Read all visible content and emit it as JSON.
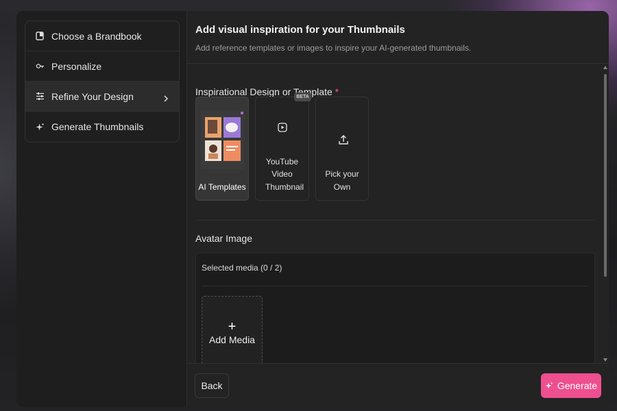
{
  "sidebar": {
    "items": [
      {
        "label": "Choose a Brandbook",
        "icon": "brandbook-icon"
      },
      {
        "label": "Personalize",
        "icon": "personalize-icon"
      },
      {
        "label": "Refine Your Design",
        "icon": "sliders-icon",
        "active": true
      },
      {
        "label": "Generate Thumbnails",
        "icon": "sparkle-icon"
      }
    ]
  },
  "header": {
    "title": "Add visual inspiration for your Thumbnails",
    "subtitle": "Add reference templates or images to inspire your AI-generated thumbnails."
  },
  "inspiration": {
    "title": "Inspirational Design or Template",
    "required_mark": "*",
    "options": [
      {
        "label": "AI Templates",
        "selected": true
      },
      {
        "label": "YouTube Video Thumbnail",
        "badge": "BETA",
        "icon": "play-icon"
      },
      {
        "label": "Pick your Own",
        "icon": "upload-icon"
      }
    ]
  },
  "avatar": {
    "title": "Avatar Image",
    "selected_media": "Selected media (0 / 2)",
    "add_media_plus": "+",
    "add_media_label": "Add Media"
  },
  "footer": {
    "back_label": "Back",
    "generate_label": "Generate"
  },
  "colors": {
    "accent": "#ee4f8e",
    "required": "#ff5a7a",
    "panel": "#232323",
    "sidebar": "#1e1e1e"
  }
}
